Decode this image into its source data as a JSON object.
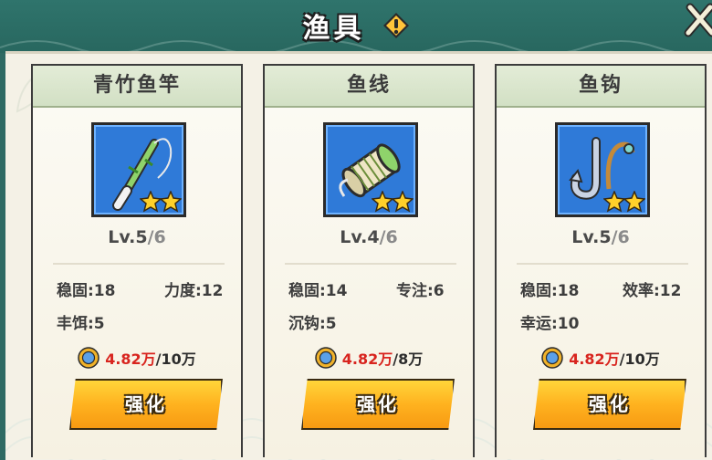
{
  "header": {
    "title": "渔具"
  },
  "currency": {
    "have": "4.82万"
  },
  "cards": [
    {
      "name": "青竹鱼竿",
      "icon": "fishing-rod-icon",
      "level": "Lv.5",
      "level_max": "/6",
      "stars": 2,
      "stats": [
        {
          "label": "稳固:18"
        },
        {
          "label": "力度:12"
        },
        {
          "label": "丰饵:5"
        }
      ],
      "cost_need": "/10万",
      "button": "强化"
    },
    {
      "name": "鱼线",
      "icon": "fishing-line-spool-icon",
      "level": "Lv.4",
      "level_max": "/6",
      "stars": 2,
      "stats": [
        {
          "label": "稳固:14"
        },
        {
          "label": "专注:6"
        },
        {
          "label": "沉钩:5"
        }
      ],
      "cost_need": "/8万",
      "button": "强化"
    },
    {
      "name": "鱼钩",
      "icon": "fish-hook-icon",
      "level": "Lv.5",
      "level_max": "/6",
      "stars": 2,
      "stats": [
        {
          "label": "稳固:18"
        },
        {
          "label": "效率:12"
        },
        {
          "label": "幸运:10"
        }
      ],
      "cost_need": "/10万",
      "button": "强化"
    }
  ],
  "colors": {
    "accent": "#ffb21f",
    "cost_red": "#d8241e",
    "item_bg": "#2f7ad8",
    "header_bg": "#2f746c"
  }
}
